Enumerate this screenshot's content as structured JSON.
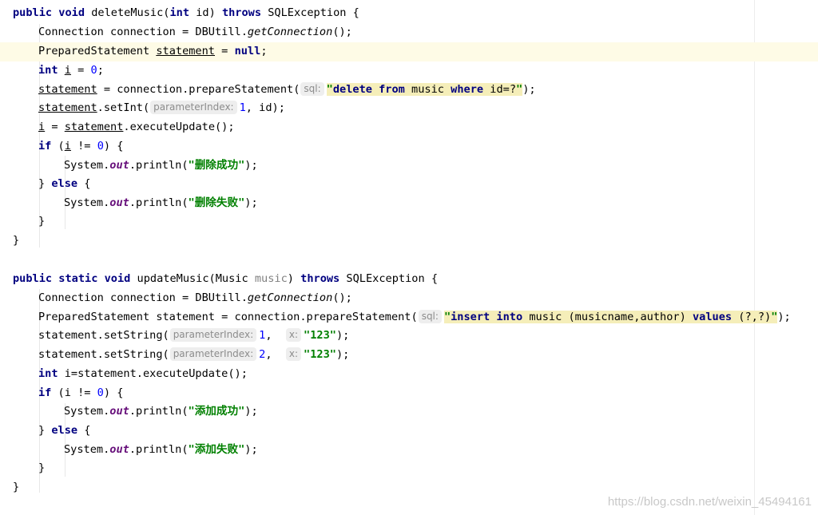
{
  "editor": {
    "lines": [
      [
        "public",
        " ",
        "void",
        " deleteMusic(",
        "int",
        " id) ",
        "throws",
        " SQLException {"
      ],
      [
        "Connection connection = DBUtill.",
        "getConnection",
        "();"
      ],
      [
        "PreparedStatement ",
        "statement",
        " = ",
        "null",
        ";"
      ],
      [
        "int",
        " ",
        "i",
        " = ",
        "0",
        ";"
      ],
      [
        "statement",
        " = connection.prepareStatement(",
        "sql:",
        "\"",
        "delete",
        " ",
        "from",
        " music ",
        "where",
        " id=?",
        "\"",
        ");"
      ],
      [
        "statement",
        ".setInt(",
        "parameterIndex:",
        "1",
        ", id);"
      ],
      [
        "i",
        " = ",
        "statement",
        ".executeUpdate();"
      ],
      [
        "if",
        " (",
        "i",
        " != ",
        "0",
        ") {"
      ],
      [
        "System.",
        "out",
        ".println(",
        "\"删除成功\"",
        ");"
      ],
      [
        "} ",
        "else",
        " {"
      ],
      [
        "System.",
        "out",
        ".println(",
        "\"删除失败\"",
        ");"
      ],
      [
        "}"
      ],
      [
        "}"
      ],
      [
        "public",
        " ",
        "static",
        " ",
        "void",
        " updateMusic(Music ",
        "music",
        ") ",
        "throws",
        " SQLException {"
      ],
      [
        "Connection connection = DBUtill.",
        "getConnection",
        "();"
      ],
      [
        "PreparedStatement statement = connection.prepareStatement(",
        "sql:",
        "\"",
        "insert",
        " ",
        "into",
        " music (musicname,author) ",
        "values",
        " (?,?)",
        "\"",
        ");"
      ],
      [
        "statement.setString(",
        "parameterIndex:",
        "1",
        ",  ",
        "x:",
        "\"123\"",
        ");"
      ],
      [
        "statement.setString(",
        "parameterIndex:",
        "2",
        ",  ",
        "x:",
        "\"123\"",
        ");"
      ],
      [
        "int",
        " i=statement.executeUpdate();"
      ],
      [
        "if",
        " (i != ",
        "0",
        ") {"
      ],
      [
        "System.",
        "out",
        ".println(",
        "\"添加成功\"",
        ");"
      ],
      [
        "} ",
        "else",
        " {"
      ],
      [
        "System.",
        "out",
        ".println(",
        "\"添加失败\"",
        ");"
      ],
      [
        "}"
      ],
      [
        "}"
      ]
    ]
  },
  "watermark": "https://blog.csdn.net/weixin_45494161"
}
